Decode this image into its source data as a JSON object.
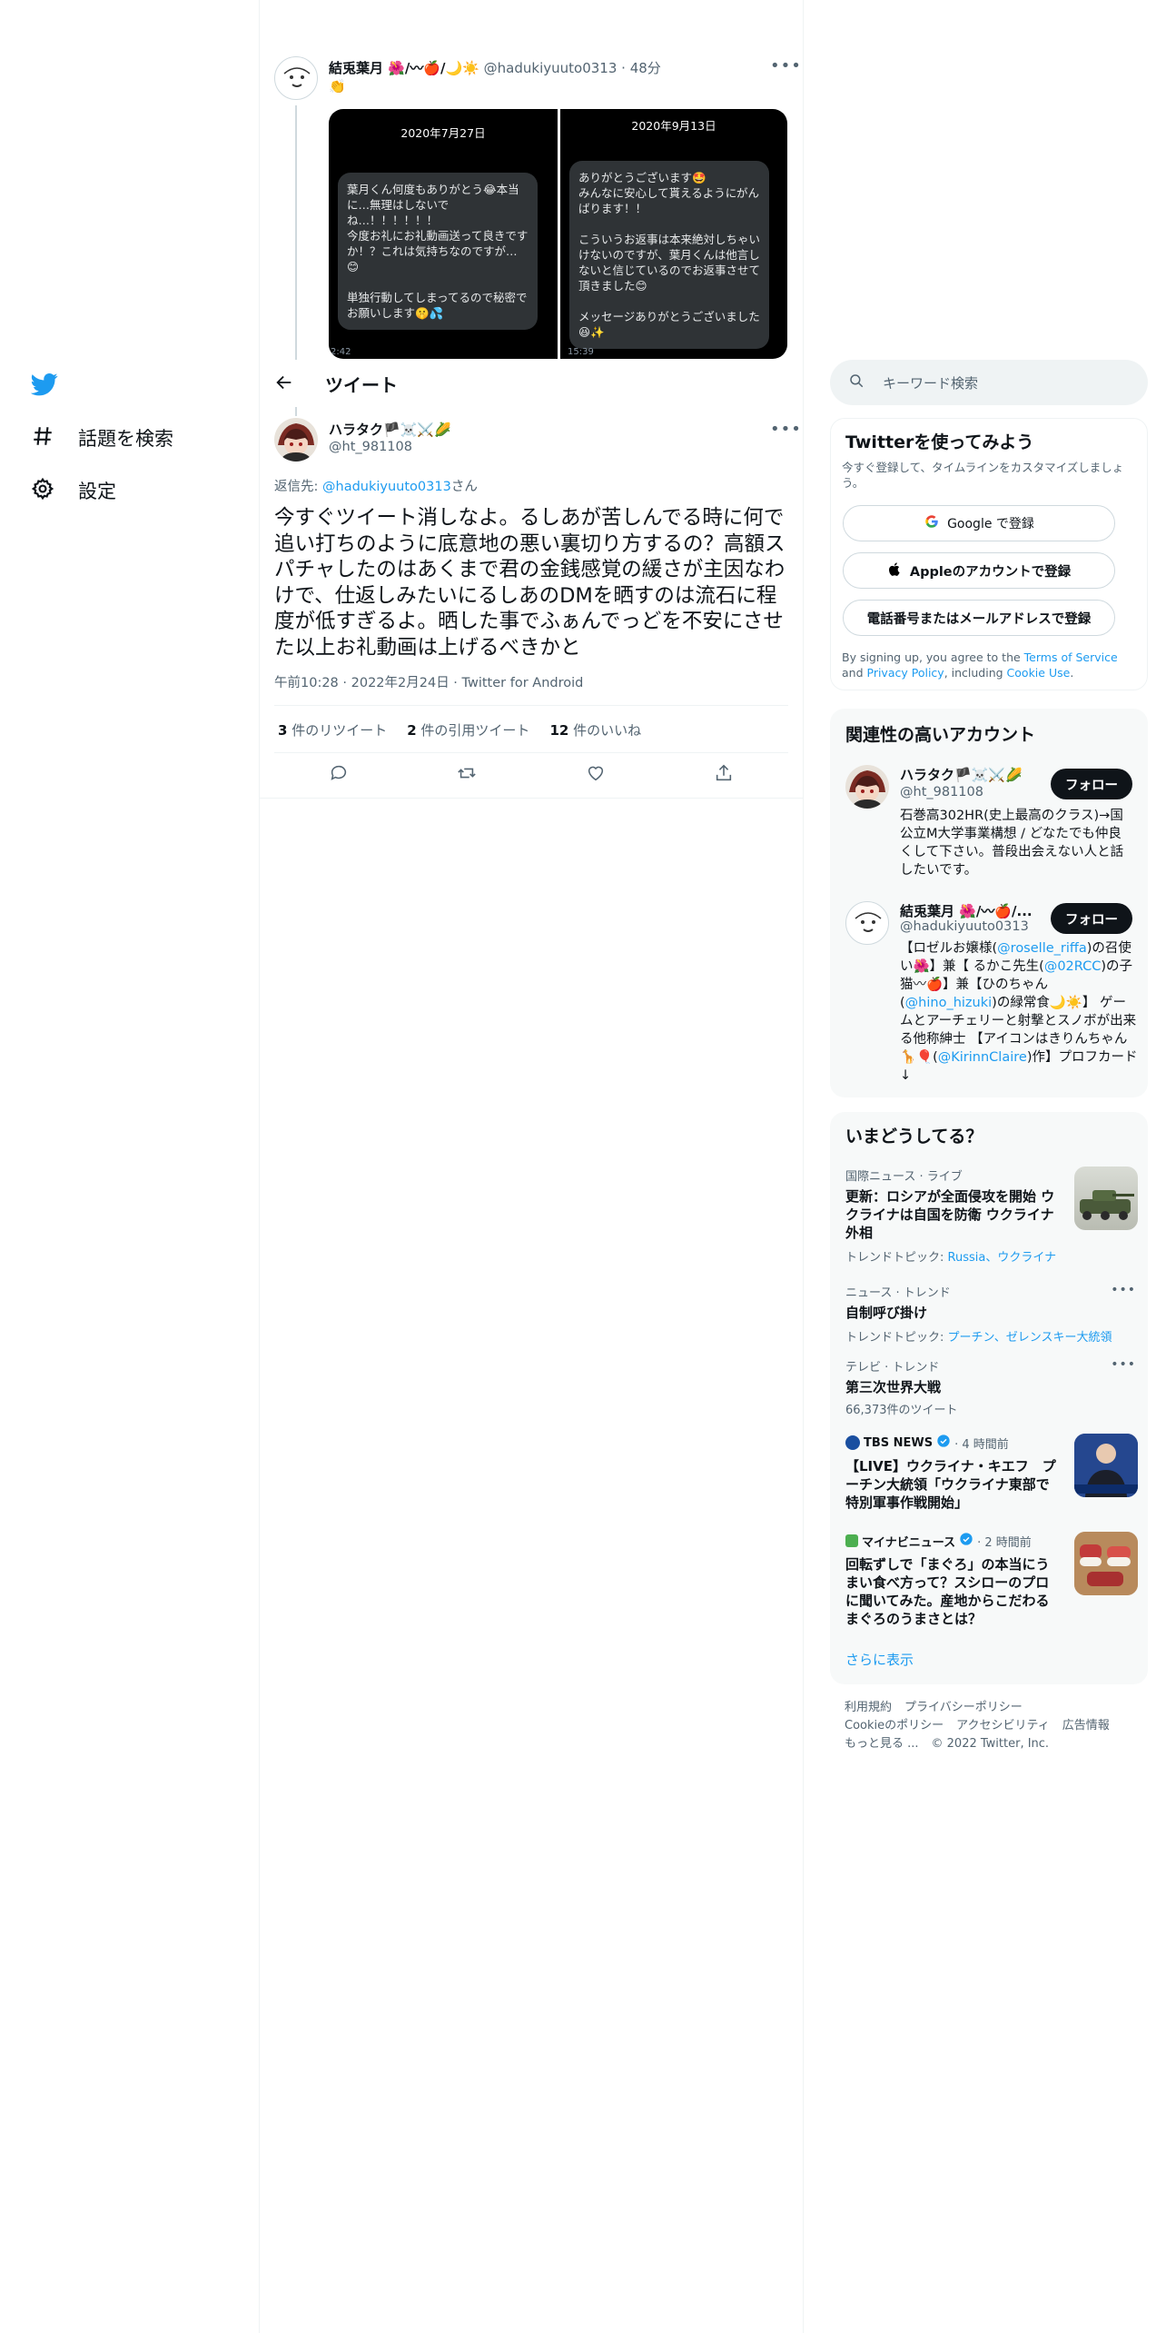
{
  "nav": {
    "items": [
      {
        "label": "話題を検索",
        "icon": "hashtag-icon"
      },
      {
        "label": "設定",
        "icon": "gear-icon"
      }
    ]
  },
  "header": {
    "title": "ツイート"
  },
  "parent_tweet": {
    "name": "結兎葉月 🌺/〰🍎/🌙☀️",
    "handle": "@hadukiyuuto0313",
    "time": "· 48分",
    "emoji": "👏",
    "photo_left": {
      "date": "2020年7月27日",
      "message": "葉月くん何度もありがとう😂本当に…無理はしないでね…！！！！！！\n今度お礼にお礼動画送って良きですか！？これは気持ちなのですが…😊\n\n単独行動してしまってるので秘密でお願いします🤫💦",
      "timestamp": "2:42"
    },
    "photo_right": {
      "date": "2020年9月13日",
      "message": "ありがとうございます🤩\nみんなに安心して貰えるようにがんばります！！\n\nこういうお返事は本来絶対しちゃいけないのですが、葉月くんは他言しないと信じているのでお返事させて頂きました😊\n\nメッセージありがとうございました😆✨",
      "timestamp": "15:39"
    }
  },
  "main_tweet": {
    "name": "ハラタク🏴☠️⚔️🌽",
    "handle": "@ht_981108",
    "reply_to_prefix": "返信先: ",
    "reply_to_handle": "@hadukiyuuto0313",
    "reply_to_suffix": "さん",
    "text": "今すぐツイート消しなよ。るしあが苦しんでる時に何で追い打ちのように底意地の悪い裏切り方するの？高額スパチャしたのはあくまで君の金銭感覚の緩さが主因なわけで、仕返しみたいにるしあのDMを晒すのは流石に程度が低すぎるよ。晒した事でふぁんでっどを不安にさせた以上お礼動画は上げるべきかと",
    "meta": "午前10:28 · 2022年2月24日 · Twitter for Android",
    "stats": {
      "retweets": "3",
      "retweets_label": " 件のリツイート",
      "quotes": "2",
      "quotes_label": " 件の引用ツイート",
      "likes": "12",
      "likes_label": " 件のいいね"
    }
  },
  "search": {
    "placeholder": "キーワード検索"
  },
  "signup": {
    "title": "Twitterを使ってみよう",
    "subtitle": "今すぐ登録して、タイムラインをカスタマイズしましょう。",
    "google": "Google で登録",
    "apple": "Appleのアカウントで登録",
    "phone": "電話番号またはメールアドレスで登録",
    "legal_1": "By signing up, you agree to the ",
    "legal_tos": "Terms of Service",
    "legal_2": " and ",
    "legal_privacy": "Privacy Policy",
    "legal_3": ", including ",
    "legal_cookie": "Cookie Use",
    "legal_4": "."
  },
  "related": {
    "title": "関連性の高いアカウント",
    "follow_label": "フォロー",
    "accounts": [
      {
        "name": "ハラタク🏴☠️⚔️🌽",
        "handle": "@ht_981108",
        "bio": "石巻高302HR(史上最高のクラス)→国公立M大学事業構想 / どなたでも仲良くして下さい。普段出会えない人と話したいです。"
      },
      {
        "name": "結兎葉月 🌺/〰🍎/...",
        "handle": "@hadukiyuuto0313",
        "bio_1": "【ロゼルお嬢様(",
        "bio_link1": "@roselle_riffa",
        "bio_2": ")の召使い🌺】兼【 るかこ先生(",
        "bio_link2": "@02RCC",
        "bio_3": ")の子猫〰🍎】兼【ひのちゃん(",
        "bio_link3": "@hino_hizuki",
        "bio_4": ")の緑常食🌙☀️】 ゲームとアーチェリーと射撃とスノボが出来る他称紳士 【アイコンはきりんちゃん🦒🎈(",
        "bio_link4": "@KirinnClaire",
        "bio_5": ")作】プロフカード↓"
      }
    ]
  },
  "trends": {
    "title": "いまどうしてる？",
    "items": [
      {
        "meta": "国際ニュース · ライブ",
        "title": "更新：ロシアが全面侵攻を開始 ウクライナは自国を防衛 ウクライナ外相",
        "topic_prefix": "トレンドトピック: ",
        "topic": "Russia、ウクライナ"
      },
      {
        "meta": "ニュース · トレンド",
        "title": "自制呼び掛け",
        "topic_prefix": "トレンドトピック: ",
        "topic": "プーチン、ゼレンスキー大統領"
      },
      {
        "meta": "テレビ · トレンド",
        "title": "第三次世界大戦",
        "count": "66,373件のツイート"
      },
      {
        "source": "TBS NEWS",
        "time": "· 4 時間前",
        "title": "【LIVE】ウクライナ・キエフ　プーチン大統領「ウクライナ東部で特別軍事作戦開始」"
      },
      {
        "source": "マイナビニュース",
        "time": "· 2 時間前",
        "title": "回転ずしで「まぐろ」の本当にうまい食べ方って？スシローのプロに聞いてみた。産地からこだわるまぐろのうまさとは？"
      }
    ],
    "show_more": "さらに表示"
  },
  "footer": {
    "links_row1": [
      "利用規約",
      "プライバシーポリシー"
    ],
    "links_row2": [
      "Cookieのポリシー",
      "アクセシビリティ",
      "広告情報"
    ],
    "more": "もっと見る ...",
    "copyright": "© 2022 Twitter, Inc."
  },
  "colors": {
    "accent": "#1d9bf0",
    "text": "#0f1419",
    "muted": "#536471"
  }
}
